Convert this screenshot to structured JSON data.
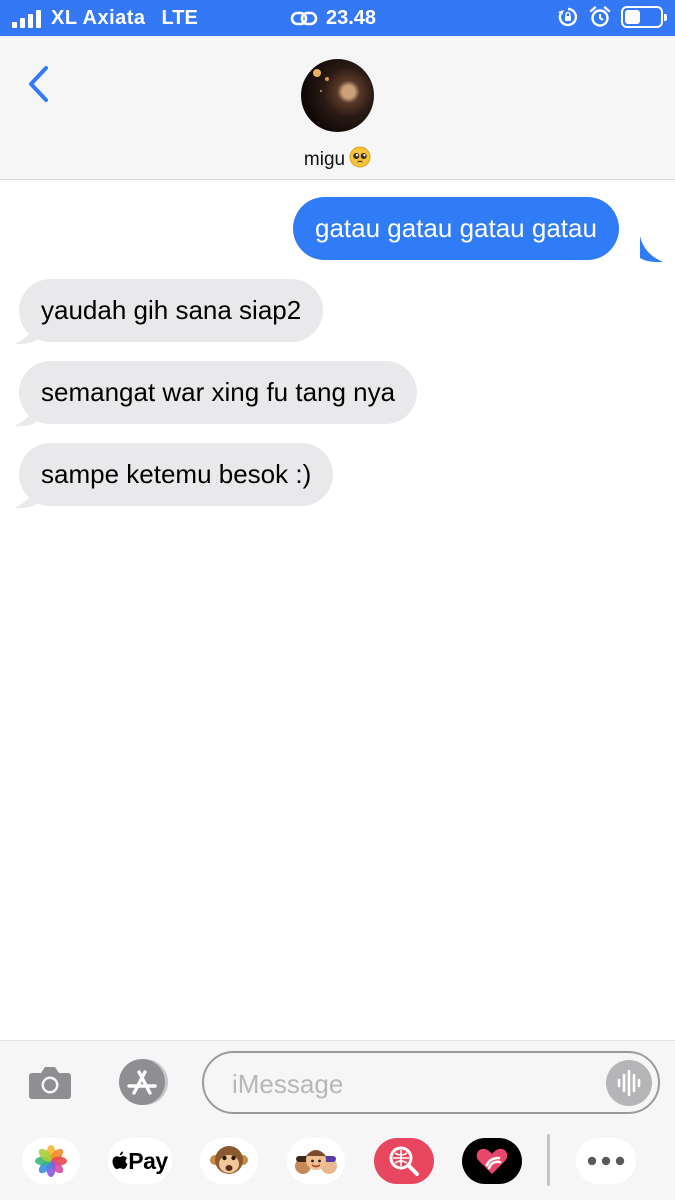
{
  "status_bar": {
    "carrier": "XL Axiata",
    "network": "LTE",
    "time": "23.48",
    "battery_level": 0.45
  },
  "header": {
    "contact_name": "migu",
    "contact_emoji": "pleading-face-icon"
  },
  "messages": [
    {
      "from": "me",
      "text": "gatau gatau gatau gatau"
    },
    {
      "from": "them",
      "text": "yaudah gih sana siap2"
    },
    {
      "from": "them",
      "text": "semangat war xing fu tang nya"
    },
    {
      "from": "them",
      "text": "sampe ketemu besok :)"
    }
  ],
  "input": {
    "placeholder": "iMessage"
  },
  "app_drawer": {
    "apple_pay_label": "Pay",
    "items": [
      "photos-app-icon",
      "apple-pay-icon",
      "animoji-icon",
      "memoji-stickers-icon",
      "images-search-icon",
      "digital-touch-icon",
      "more-icon"
    ]
  },
  "colors": {
    "status_bar": "#3478f6",
    "sent_bubble": "#2f7cf6",
    "received_bubble": "#e9e9eb",
    "accent": "#2f7cf6"
  }
}
